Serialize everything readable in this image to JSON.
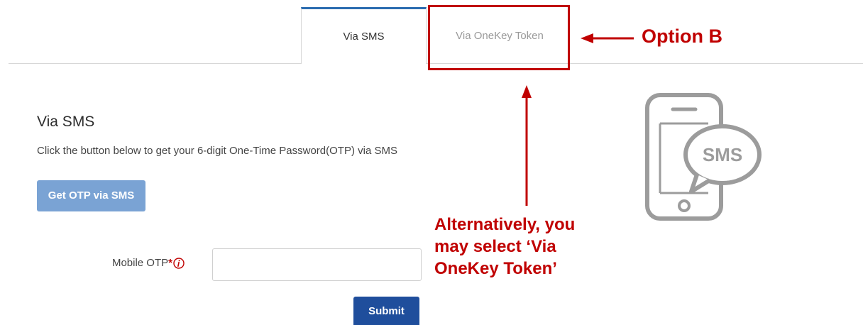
{
  "tabs": {
    "sms_label": "Via SMS",
    "onekey_label": "Via OneKey Token",
    "active": "Via SMS"
  },
  "main": {
    "section_title": "Via SMS",
    "instructions": "Click the button below to get your 6-digit One-Time Password(OTP) via SMS",
    "get_otp_label": "Get OTP via SMS",
    "otp_field_label": "Mobile OTP",
    "required_marker": "*",
    "otp_value": "",
    "submit_label": "Submit"
  },
  "illustration": {
    "icon": "phone-sms-icon",
    "bubble_text": "SMS"
  },
  "annotations": {
    "option_b": "Option B",
    "alternative_line1": "Alternatively, you",
    "alternative_line2": "may select ‘Via",
    "alternative_line3": "OneKey Token’"
  },
  "colors": {
    "active_tab_accent": "#2b6cb0",
    "annotation_red": "#c00000",
    "get_otp_button": "#7aa3d4",
    "submit_button": "#1f4e9c"
  }
}
